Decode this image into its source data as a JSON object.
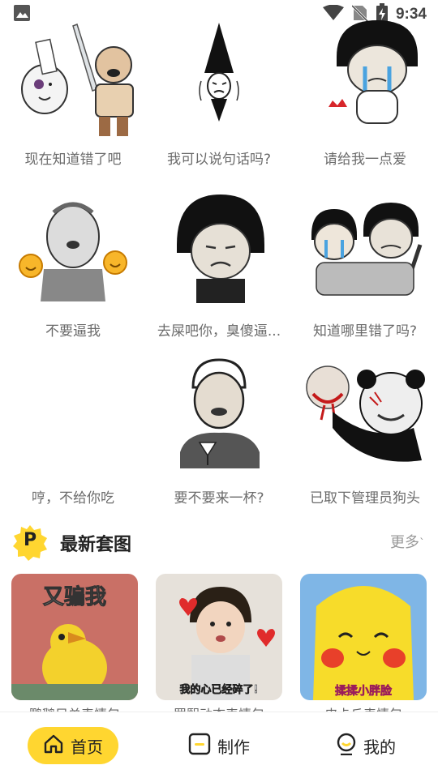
{
  "status_bar": {
    "time": "9:34"
  },
  "stickers": [
    {
      "caption": "现在知道错了吧"
    },
    {
      "caption": "我可以说句话吗?"
    },
    {
      "caption": "请给我一点爱"
    },
    {
      "caption": "不要逼我"
    },
    {
      "caption": "去屎吧你，臭傻逼..."
    },
    {
      "caption": "知道哪里错了吗?"
    },
    {
      "caption": "哼，不给你吃"
    },
    {
      "caption": "要不要来一杯?"
    },
    {
      "caption": "已取下管理员狗头"
    }
  ],
  "sticker_art": {
    "sword_sign": "",
    "shiver": ""
  },
  "section": {
    "badge_letter": "P",
    "title": "最新套图",
    "more_label": "更多"
  },
  "sets": [
    {
      "overlay_text": "又骗我",
      "title": "鹏鹅只单表情包"
    },
    {
      "overlay_text": "我的心已经碎了!",
      "title": "罗熙动态表情包"
    },
    {
      "overlay_text": "揉揉小胖脸",
      "title": "皮卡丘表情包"
    }
  ],
  "nav": {
    "home_label": "首页",
    "make_label": "制作",
    "mine_label": "我的"
  },
  "colors": {
    "accent": "#ffd630",
    "caption": "#6b6b6b"
  }
}
